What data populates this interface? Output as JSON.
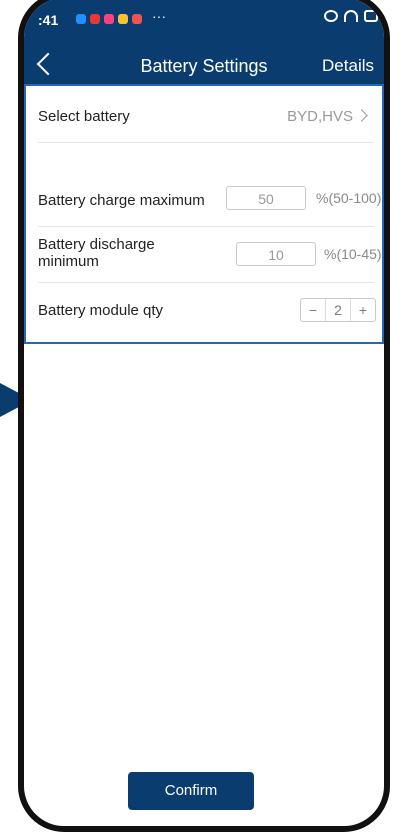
{
  "status": {
    "time": ":41",
    "more": "···"
  },
  "header": {
    "title": "Battery Settings",
    "details": "Details"
  },
  "settings": {
    "select_battery": {
      "label": "Select battery",
      "value": "BYD,HVS"
    },
    "charge_max": {
      "label": "Battery charge maximum",
      "value": "50",
      "unit": "%(50-100)"
    },
    "discharge_min": {
      "label": "Battery discharge minimum",
      "value": "10",
      "unit": "%(10-45)"
    },
    "module_qty": {
      "label": "Battery module qty",
      "value": "2",
      "minus": "−",
      "plus": "+"
    }
  },
  "footer": {
    "confirm": "Confirm"
  },
  "colors": {
    "brand": "#0b3c6f",
    "accent_outline": "#2a65b8"
  },
  "icons": [
    "back-icon",
    "chevron-right-icon",
    "wifi-icon",
    "mute-icon",
    "battery-icon"
  ]
}
